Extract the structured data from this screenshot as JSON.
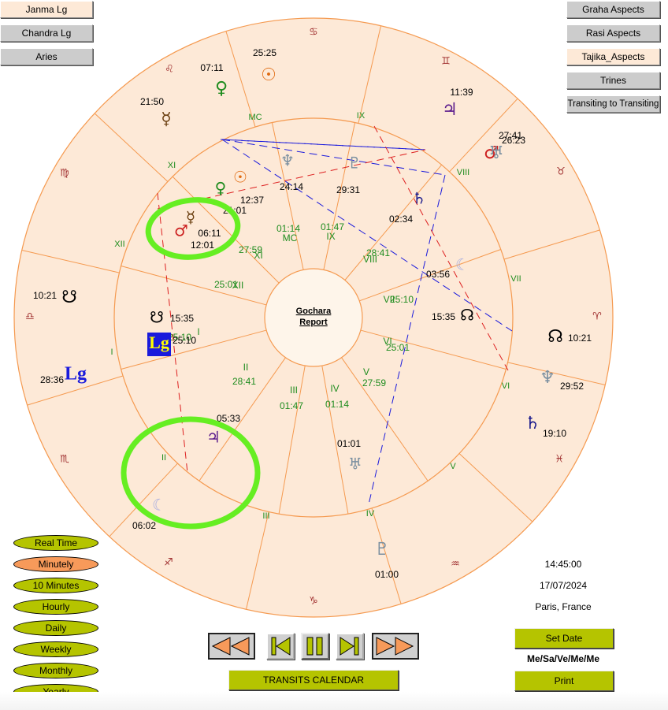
{
  "left_buttons": [
    {
      "label": "Janma Lg",
      "active": true
    },
    {
      "label": "Chandra Lg",
      "active": false
    },
    {
      "label": "Aries",
      "active": false
    }
  ],
  "right_buttons": [
    {
      "label": "Graha Aspects",
      "active": false
    },
    {
      "label": "Rasi Aspects",
      "active": false
    },
    {
      "label": "Tajika_Aspects",
      "active": true
    },
    {
      "label": "Trines",
      "active": false
    },
    {
      "label": "Transiting to Transiting",
      "active": false
    }
  ],
  "chart": {
    "center_title_line1": "Gochara",
    "center_title_line2": "Report",
    "zodiac_signs": [
      {
        "name": "aries",
        "glyph": "♈"
      },
      {
        "name": "taurus",
        "glyph": "♉"
      },
      {
        "name": "gemini",
        "glyph": "♊"
      },
      {
        "name": "cancer",
        "glyph": "♋"
      },
      {
        "name": "leo",
        "glyph": "♌"
      },
      {
        "name": "virgo",
        "glyph": "♍"
      },
      {
        "name": "libra",
        "glyph": "♎"
      },
      {
        "name": "scorpio",
        "glyph": "♏"
      },
      {
        "name": "sagittarius",
        "glyph": "♐"
      },
      {
        "name": "capricorn",
        "glyph": "♑"
      },
      {
        "name": "aquarius",
        "glyph": "♒"
      },
      {
        "name": "pisces",
        "glyph": "♓"
      }
    ],
    "transit_planets": [
      {
        "name": "sun",
        "glyph": "☉",
        "degree": "25:25",
        "color": "#e06a10"
      },
      {
        "name": "venus",
        "glyph": "♀",
        "degree": "07:11",
        "color": "#1e8c1e"
      },
      {
        "name": "mercury",
        "glyph": "☿",
        "degree": "21:50",
        "color": "#6b3f10"
      },
      {
        "name": "jupiter",
        "glyph": "♃",
        "degree": "11:39",
        "color": "#5a1a8c"
      },
      {
        "name": "mars",
        "glyph": "♂",
        "degree": "27:41",
        "color": "#cc2020"
      },
      {
        "name": "uranus",
        "glyph": "♅",
        "degree": "26:23",
        "color": "#7a8fa0"
      },
      {
        "name": "rahu",
        "glyph": "☊",
        "degree": "10:21",
        "color": "#000000"
      },
      {
        "name": "ketu",
        "glyph": "☋",
        "degree": "10:21",
        "color": "#000000"
      },
      {
        "name": "neptune",
        "glyph": "♆",
        "degree": "29:52",
        "color": "#7a8fa0"
      },
      {
        "name": "saturn",
        "glyph": "♄",
        "degree": "19:10",
        "color": "#1a1a8c"
      },
      {
        "name": "pluto",
        "glyph": "♇",
        "degree": "01:00",
        "color": "#7a8fa0"
      },
      {
        "name": "lagna",
        "glyph": "Lg",
        "degree": "28:36",
        "color": "#1a1adc"
      }
    ],
    "natal_planets": [
      {
        "name": "sun",
        "glyph": "☉",
        "degree": "12:37",
        "color": "#e06a10"
      },
      {
        "name": "venus",
        "glyph": "♀",
        "degree": "21:01",
        "color": "#1e8c1e"
      },
      {
        "name": "mercury",
        "glyph": "☿",
        "degree": "06:11",
        "color": "#6b3f10"
      },
      {
        "name": "mars",
        "glyph": "♂",
        "degree": "12:01",
        "color": "#cc2020"
      },
      {
        "name": "neptune",
        "glyph": "♆",
        "degree": "24:14",
        "color": "#7a8fa0"
      },
      {
        "name": "pluto",
        "glyph": "♇",
        "degree": "29:31",
        "color": "#7a8fa0"
      },
      {
        "name": "saturn",
        "glyph": "♄",
        "degree": "02:34",
        "color": "#1a1a8c"
      },
      {
        "name": "moon",
        "glyph": "☾",
        "degree": "03:56",
        "color": "#a8aee0"
      },
      {
        "name": "rahu",
        "glyph": "☊",
        "degree": "15:35",
        "color": "#000000"
      },
      {
        "name": "ketu",
        "glyph": "☋",
        "degree": "15:35",
        "color": "#000000"
      },
      {
        "name": "lagna",
        "glyph": "Lg",
        "degree": "25:10",
        "color": "#ffff00"
      },
      {
        "name": "jupiter",
        "glyph": "♃",
        "degree": "05:33",
        "color": "#5a1a8c"
      },
      {
        "name": "moon-transit",
        "glyph": "☾",
        "degree": "06:02",
        "color": "#a8aee0"
      },
      {
        "name": "uranus",
        "glyph": "♅",
        "degree": "01:01",
        "color": "#7a8fa0"
      }
    ],
    "house_cusps": [
      {
        "house": "I",
        "degree": "25:10"
      },
      {
        "house": "II",
        "degree": "28:41"
      },
      {
        "house": "III",
        "degree": "01:47"
      },
      {
        "house": "IV",
        "degree": "01:14"
      },
      {
        "house": "V",
        "degree": "27:59"
      },
      {
        "house": "VI",
        "degree": "25:01"
      },
      {
        "house": "VII",
        "degree": "25:10"
      },
      {
        "house": "VIII",
        "degree": "28:41"
      },
      {
        "house": "IX",
        "degree": "01:47"
      },
      {
        "house": "MC",
        "degree": "01:14"
      },
      {
        "house": "XI",
        "degree": "27:59"
      },
      {
        "house": "XII",
        "degree": "25:01"
      }
    ]
  },
  "speed_options": [
    {
      "label": "Real Time",
      "active": false
    },
    {
      "label": "Minutely",
      "active": true
    },
    {
      "label": "10 Minutes",
      "active": false
    },
    {
      "label": "Hourly",
      "active": false
    },
    {
      "label": "Daily",
      "active": false
    },
    {
      "label": "Weekly",
      "active": false
    },
    {
      "label": "Monthly",
      "active": false
    },
    {
      "label": "Yearly",
      "active": false
    }
  ],
  "playback": {
    "fast_back": "fast-backward",
    "step_back": "step-backward",
    "pause": "pause",
    "step_forward": "step-forward",
    "fast_forward": "fast-forward"
  },
  "transits_calendar_label": "TRANSITS CALENDAR",
  "info": {
    "time": "14:45:00",
    "date": "17/07/2024",
    "place": "Paris,  France",
    "set_date_label": "Set Date",
    "signature": "Me/Sa/Ve/Me/Me",
    "print_label": "Print"
  },
  "colors": {
    "chart_fill": "#fde9d7",
    "ring_line": "#f59a50",
    "house_label": "#1e8c1e",
    "zodiac_glyph": "#a03030",
    "highlight_ring": "#66ee22",
    "aspect_blue": "#1a1adc",
    "aspect_red": "#dd2020",
    "button_olive": "#b5c400",
    "button_orange": "#f79a5a"
  }
}
